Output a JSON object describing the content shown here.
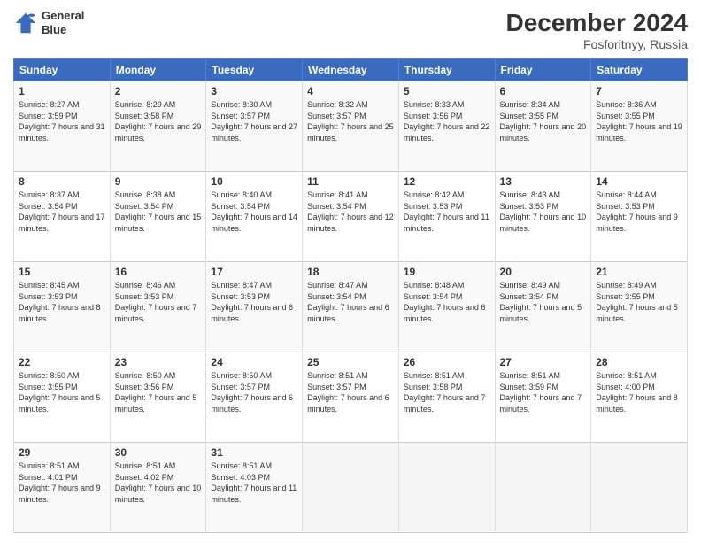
{
  "header": {
    "logo_line1": "General",
    "logo_line2": "Blue",
    "month_title": "December 2024",
    "location": "Fosforitnyy, Russia"
  },
  "weekdays": [
    "Sunday",
    "Monday",
    "Tuesday",
    "Wednesday",
    "Thursday",
    "Friday",
    "Saturday"
  ],
  "weeks": [
    [
      {
        "day": "1",
        "sunrise": "8:27 AM",
        "sunset": "3:59 PM",
        "daylight": "7 hours and 31 minutes."
      },
      {
        "day": "2",
        "sunrise": "8:29 AM",
        "sunset": "3:58 PM",
        "daylight": "7 hours and 29 minutes."
      },
      {
        "day": "3",
        "sunrise": "8:30 AM",
        "sunset": "3:57 PM",
        "daylight": "7 hours and 27 minutes."
      },
      {
        "day": "4",
        "sunrise": "8:32 AM",
        "sunset": "3:57 PM",
        "daylight": "7 hours and 25 minutes."
      },
      {
        "day": "5",
        "sunrise": "8:33 AM",
        "sunset": "3:56 PM",
        "daylight": "7 hours and 22 minutes."
      },
      {
        "day": "6",
        "sunrise": "8:34 AM",
        "sunset": "3:55 PM",
        "daylight": "7 hours and 20 minutes."
      },
      {
        "day": "7",
        "sunrise": "8:36 AM",
        "sunset": "3:55 PM",
        "daylight": "7 hours and 19 minutes."
      }
    ],
    [
      {
        "day": "8",
        "sunrise": "8:37 AM",
        "sunset": "3:54 PM",
        "daylight": "7 hours and 17 minutes."
      },
      {
        "day": "9",
        "sunrise": "8:38 AM",
        "sunset": "3:54 PM",
        "daylight": "7 hours and 15 minutes."
      },
      {
        "day": "10",
        "sunrise": "8:40 AM",
        "sunset": "3:54 PM",
        "daylight": "7 hours and 14 minutes."
      },
      {
        "day": "11",
        "sunrise": "8:41 AM",
        "sunset": "3:54 PM",
        "daylight": "7 hours and 12 minutes."
      },
      {
        "day": "12",
        "sunrise": "8:42 AM",
        "sunset": "3:53 PM",
        "daylight": "7 hours and 11 minutes."
      },
      {
        "day": "13",
        "sunrise": "8:43 AM",
        "sunset": "3:53 PM",
        "daylight": "7 hours and 10 minutes."
      },
      {
        "day": "14",
        "sunrise": "8:44 AM",
        "sunset": "3:53 PM",
        "daylight": "7 hours and 9 minutes."
      }
    ],
    [
      {
        "day": "15",
        "sunrise": "8:45 AM",
        "sunset": "3:53 PM",
        "daylight": "7 hours and 8 minutes."
      },
      {
        "day": "16",
        "sunrise": "8:46 AM",
        "sunset": "3:53 PM",
        "daylight": "7 hours and 7 minutes."
      },
      {
        "day": "17",
        "sunrise": "8:47 AM",
        "sunset": "3:53 PM",
        "daylight": "7 hours and 6 minutes."
      },
      {
        "day": "18",
        "sunrise": "8:47 AM",
        "sunset": "3:54 PM",
        "daylight": "7 hours and 6 minutes."
      },
      {
        "day": "19",
        "sunrise": "8:48 AM",
        "sunset": "3:54 PM",
        "daylight": "7 hours and 6 minutes."
      },
      {
        "day": "20",
        "sunrise": "8:49 AM",
        "sunset": "3:54 PM",
        "daylight": "7 hours and 5 minutes."
      },
      {
        "day": "21",
        "sunrise": "8:49 AM",
        "sunset": "3:55 PM",
        "daylight": "7 hours and 5 minutes."
      }
    ],
    [
      {
        "day": "22",
        "sunrise": "8:50 AM",
        "sunset": "3:55 PM",
        "daylight": "7 hours and 5 minutes."
      },
      {
        "day": "23",
        "sunrise": "8:50 AM",
        "sunset": "3:56 PM",
        "daylight": "7 hours and 5 minutes."
      },
      {
        "day": "24",
        "sunrise": "8:50 AM",
        "sunset": "3:57 PM",
        "daylight": "7 hours and 6 minutes."
      },
      {
        "day": "25",
        "sunrise": "8:51 AM",
        "sunset": "3:57 PM",
        "daylight": "7 hours and 6 minutes."
      },
      {
        "day": "26",
        "sunrise": "8:51 AM",
        "sunset": "3:58 PM",
        "daylight": "7 hours and 7 minutes."
      },
      {
        "day": "27",
        "sunrise": "8:51 AM",
        "sunset": "3:59 PM",
        "daylight": "7 hours and 7 minutes."
      },
      {
        "day": "28",
        "sunrise": "8:51 AM",
        "sunset": "4:00 PM",
        "daylight": "7 hours and 8 minutes."
      }
    ],
    [
      {
        "day": "29",
        "sunrise": "8:51 AM",
        "sunset": "4:01 PM",
        "daylight": "7 hours and 9 minutes."
      },
      {
        "day": "30",
        "sunrise": "8:51 AM",
        "sunset": "4:02 PM",
        "daylight": "7 hours and 10 minutes."
      },
      {
        "day": "31",
        "sunrise": "8:51 AM",
        "sunset": "4:03 PM",
        "daylight": "7 hours and 11 minutes."
      },
      null,
      null,
      null,
      null
    ]
  ]
}
